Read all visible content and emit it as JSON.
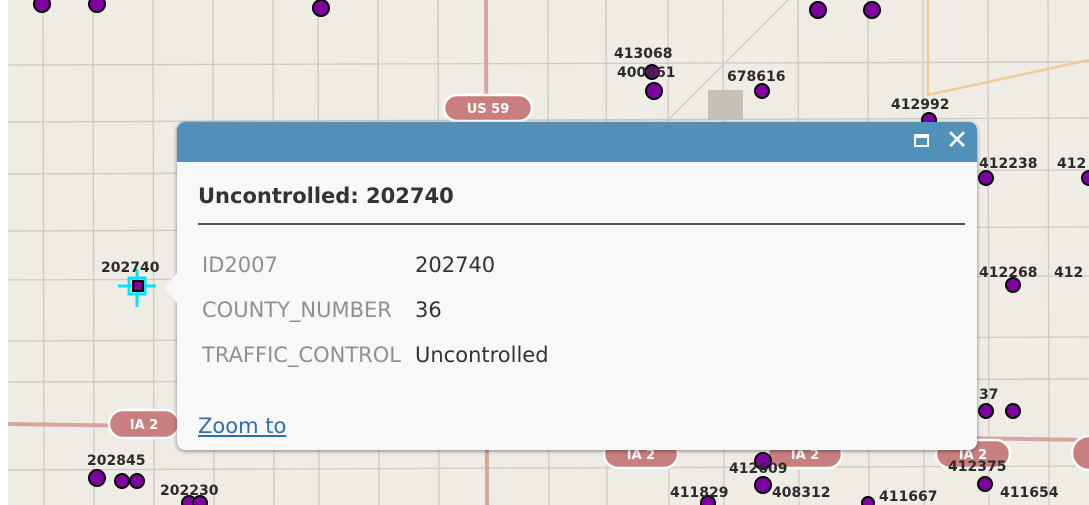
{
  "map": {
    "colors": {
      "land": "#efece6",
      "road": "#cfcbc3",
      "highway": "#d9a3a0",
      "shield": "#c97f7f",
      "point_fill": "#7f00a0",
      "point_stroke": "#000000",
      "selection": "#00e5ff"
    },
    "point_labels": [
      "413068",
      "400861",
      "678616",
      "412992",
      "412238",
      "412",
      "202740",
      "412268",
      "412",
      "37",
      "202845",
      "202230",
      "412609",
      "412375",
      "411829",
      "408312",
      "411667",
      "411654"
    ],
    "shields": [
      "US 59",
      "IA 2",
      "IA 2",
      "IA 2",
      "IA 2"
    ]
  },
  "popup": {
    "title": "Uncontrolled: 202740",
    "maximize_icon": "maximize-icon",
    "close_icon": "close-icon",
    "close_glyph": "✕",
    "attributes": [
      {
        "name": "ID2007",
        "value": "202740"
      },
      {
        "name": "COUNTY_NUMBER",
        "value": "36"
      },
      {
        "name": "TRAFFIC_CONTROL",
        "value": "Uncontrolled"
      }
    ],
    "zoom_label": "Zoom to"
  }
}
